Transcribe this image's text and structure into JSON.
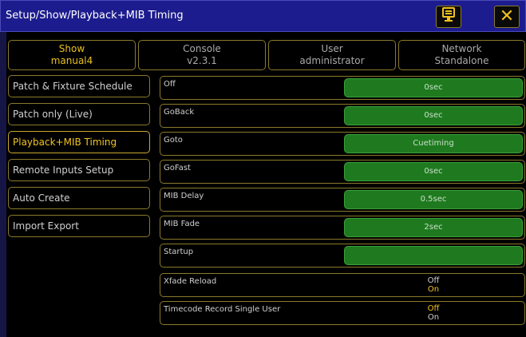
{
  "window": {
    "title": "Setup/Show/Playback+MIB Timing",
    "properties_icon": "properties-icon",
    "close_icon": "close-x-icon"
  },
  "tabs": [
    {
      "label": "Show",
      "value": "manual4",
      "active": true
    },
    {
      "label": "Console",
      "value": "v2.3.1",
      "active": false
    },
    {
      "label": "User",
      "value": "administrator",
      "active": false
    },
    {
      "label": "Network",
      "value": "Standalone",
      "active": false
    }
  ],
  "menu": [
    {
      "label": "Patch & Fixture Schedule",
      "active": false
    },
    {
      "label": "Patch only (Live)",
      "active": false
    },
    {
      "label": "Playback+MIB Timing",
      "active": true
    },
    {
      "label": "Remote Inputs Setup",
      "active": false
    },
    {
      "label": "Auto Create",
      "active": false
    },
    {
      "label": "Import Export",
      "active": false
    }
  ],
  "settings": [
    {
      "label": "Off",
      "value": "0sec"
    },
    {
      "label": "GoBack",
      "value": "0sec"
    },
    {
      "label": "Goto",
      "value": "Cuetiming"
    },
    {
      "label": "GoFast",
      "value": "0sec"
    },
    {
      "label": "MIB Delay",
      "value": "0.5sec"
    },
    {
      "label": "MIB Fade",
      "value": "2sec"
    },
    {
      "label": "Startup",
      "value": ""
    }
  ],
  "toggles": [
    {
      "label": "Xfade Reload",
      "options": [
        "Off",
        "On"
      ],
      "selected": "On"
    },
    {
      "label": "Timecode Record Single User",
      "options": [
        "Off",
        "On"
      ],
      "selected": "Off"
    }
  ],
  "colors": {
    "title_bar": "#1c1c8e",
    "accent": "#f0c420",
    "value_green": "#1f7a1f"
  }
}
